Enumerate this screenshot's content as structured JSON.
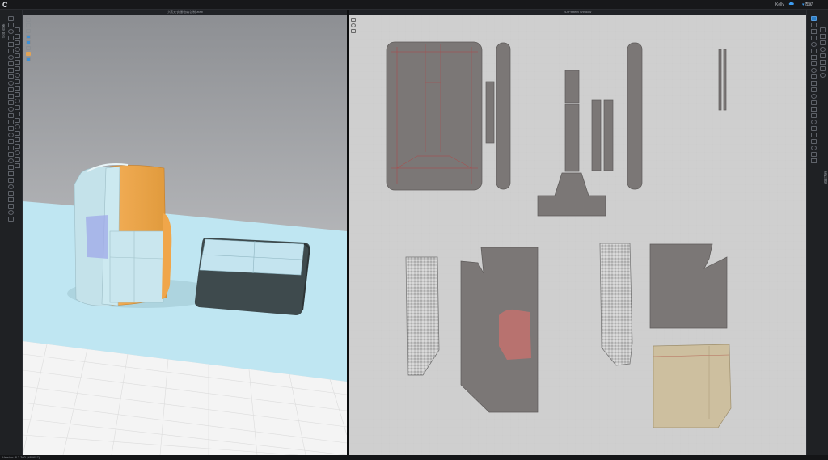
{
  "app": {
    "logo": "C"
  },
  "topbar": {
    "right_label_1": "Kelly",
    "right_label_2": "帮助"
  },
  "viewport3d": {
    "title": "小黑夹衣服帕肩包制.zfab"
  },
  "viewport2d": {
    "title": "2D Pattern Window"
  },
  "left_panel": {
    "vertical_label": "模拟 材质"
  },
  "right_panel": {
    "vertical_label": "属性编辑"
  },
  "status": {
    "text": "Version: 8.2.360 (#85657)"
  },
  "colors": {
    "background": "#1d1f22",
    "pattern_gray": "#7b7776",
    "pattern_beige": "#cdbf9f",
    "bag_lightblue": "#bfe3ee",
    "bag_orange": "#f0a64a",
    "floor_blue": "#bfe6f2",
    "sleeve_dark": "#3e4a4d",
    "accent_blue": "#2f8fe0"
  },
  "icons": [
    "logo-icon",
    "cloud-icon",
    "chevron-down-icon",
    "select-tool-icon",
    "move-tool-icon",
    "pen-tool-icon",
    "zoom-tool-icon",
    "avatar-icon",
    "simulate-icon"
  ]
}
